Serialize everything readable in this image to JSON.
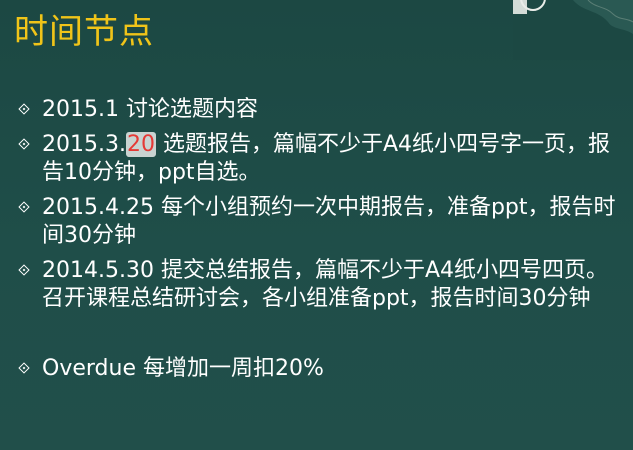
{
  "slide": {
    "title": "时间节点",
    "bullets": [
      {
        "text": "2015.1 讨论选题内容"
      },
      {
        "prefix": "2015.3.",
        "highlight": "20",
        "text": " 选题报告，篇幅不少于A4纸小四号字一页，报告10分钟，ppt自选。"
      },
      {
        "text": "2015.4.25  每个小组预约一次中期报告，准备ppt，报告时间30分钟"
      },
      {
        "text": "2014.5.30 提交总结报告，篇幅不少于A4纸小四号四页。召开课程总结研讨会，各小组准备ppt，报告时间30分钟"
      },
      {
        "text": "Overdue 每增加一周扣20%"
      }
    ]
  },
  "colors": {
    "background": "#1f4c47",
    "title": "#f0c419",
    "text": "#ffffff",
    "highlight_text": "#e53935"
  }
}
